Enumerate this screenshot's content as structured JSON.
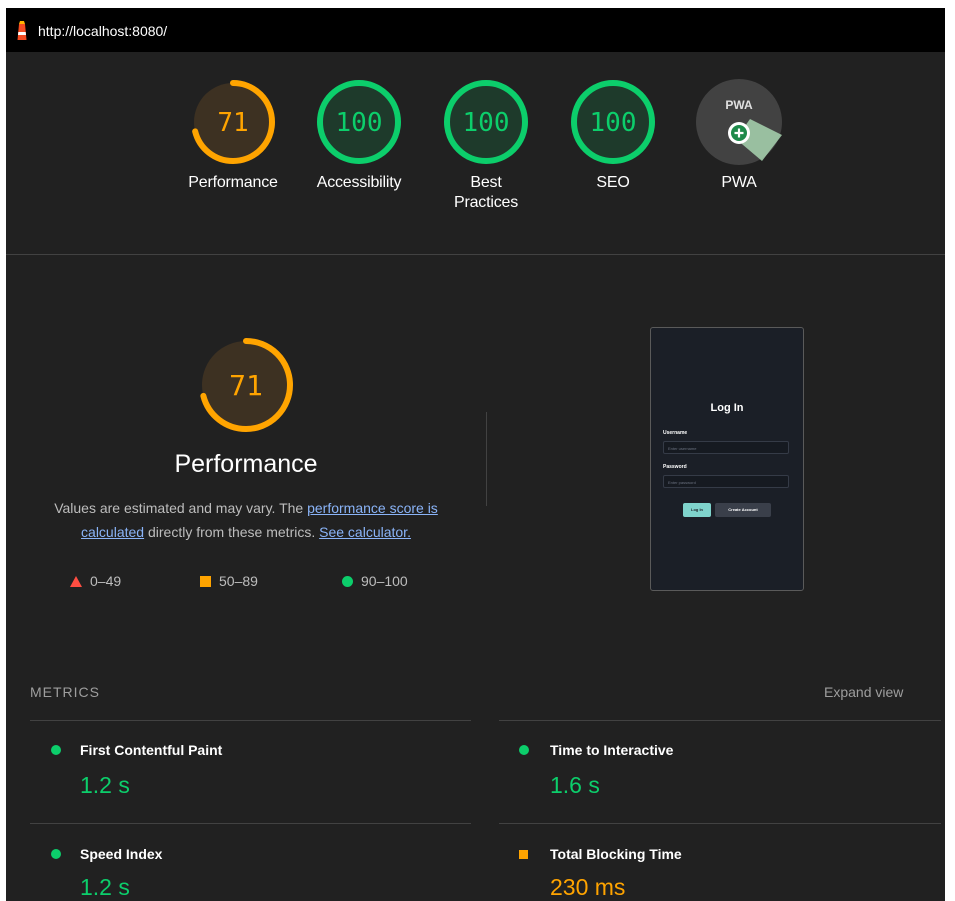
{
  "topbar": {
    "url": "http://localhost:8080/"
  },
  "scores": [
    {
      "value": "71",
      "label": "Performance",
      "status": "average"
    },
    {
      "value": "100",
      "label": "Accessibility",
      "status": "pass"
    },
    {
      "value": "100",
      "label": "Best\nPractices",
      "status": "pass"
    },
    {
      "value": "100",
      "label": "SEO",
      "status": "pass"
    },
    {
      "value": "",
      "label": "PWA",
      "status": "pwa",
      "badge_text": "PWA"
    }
  ],
  "performance": {
    "score": "71",
    "title": "Performance",
    "desc_prefix": "Values are estimated and may vary. The ",
    "desc_link1": "performance score is calculated",
    "desc_mid": " directly from these metrics. ",
    "desc_link2": "See calculator."
  },
  "legend": [
    {
      "range": "0–49",
      "shape": "triangle",
      "color": "#ff4e42"
    },
    {
      "range": "50–89",
      "shape": "square",
      "color": "#ffa400"
    },
    {
      "range": "90–100",
      "shape": "circle",
      "color": "#0cce6b"
    }
  ],
  "screenshot": {
    "title": "Log In",
    "username_label": "Username",
    "username_placeholder": "Enter username",
    "password_label": "Password",
    "password_placeholder": "Enter password",
    "login_button": "Log In",
    "create_button": "Create Account"
  },
  "metrics": {
    "heading": "METRICS",
    "expand_label": "Expand view",
    "items": [
      {
        "name": "First Contentful Paint",
        "value": "1.2 s",
        "status": "pass"
      },
      {
        "name": "Time to Interactive",
        "value": "1.6 s",
        "status": "pass"
      },
      {
        "name": "Speed Index",
        "value": "1.2 s",
        "status": "pass"
      },
      {
        "name": "Total Blocking Time",
        "value": "230 ms",
        "status": "average"
      }
    ]
  },
  "colors": {
    "pass": "#0cce6b",
    "average": "#ffa400",
    "fail": "#ff4e42",
    "pass_bg": "#1e3a2b",
    "average_bg": "#3d3122",
    "link": "#8ab4f8"
  }
}
